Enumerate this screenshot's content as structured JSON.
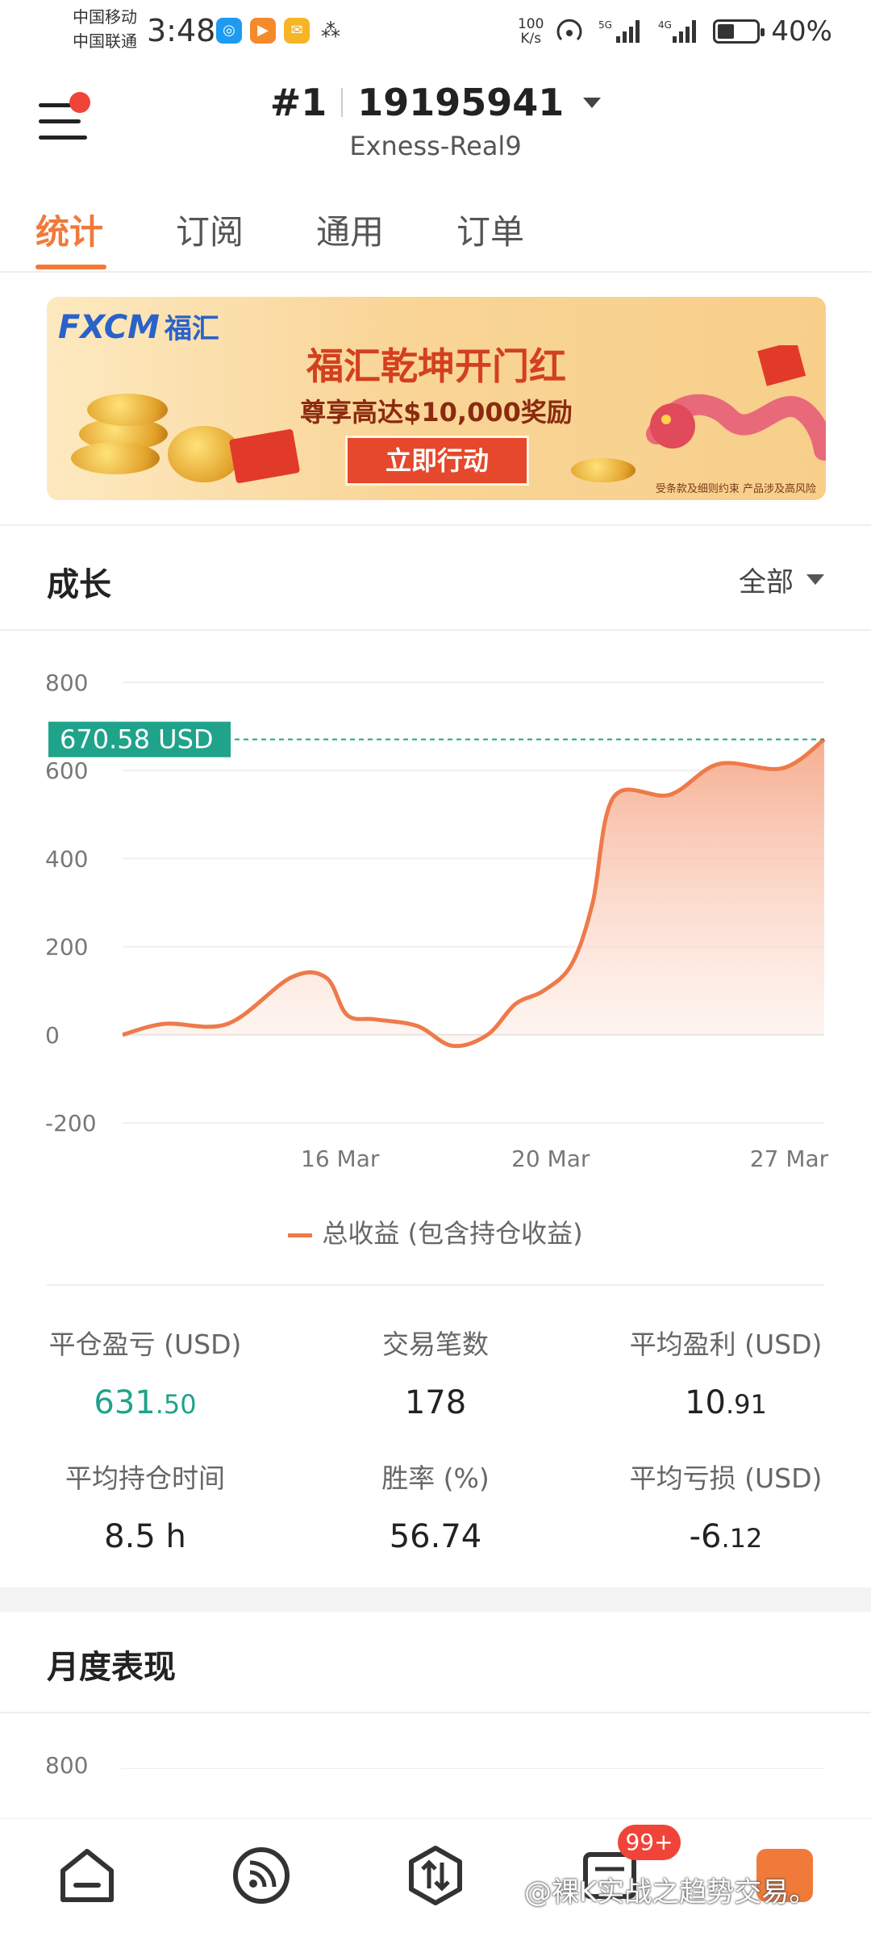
{
  "status_bar": {
    "carrier1": "中国移动",
    "carrier2": "中国联通",
    "time": "3:48",
    "net_speed_value": "100",
    "net_speed_unit": "K/s",
    "battery": "40%"
  },
  "header": {
    "account_index": "#1",
    "account_number": "19195941",
    "server": "Exness-Real9"
  },
  "tabs": [
    "统计",
    "订阅",
    "通用",
    "订单"
  ],
  "banner": {
    "brand": "FXCM",
    "brand_cn": "福汇",
    "title": "福汇乾坤开门红",
    "subtitle": "尊享高达$10,000奖励",
    "cta": "立即行动",
    "footnote": "受条款及细则约束  产品涉及高风险"
  },
  "growth": {
    "title": "成长",
    "range": "全部",
    "current_label": "670.58 USD",
    "legend": "总收益 (包含持仓收益)"
  },
  "chart_data": {
    "type": "area",
    "ylim": [
      -200,
      800
    ],
    "y_ticks": [
      800,
      600,
      400,
      200,
      0,
      -200
    ],
    "x_ticks": [
      "16 Mar",
      "20 Mar",
      "27 Mar"
    ],
    "series": [
      {
        "name": "总收益 (包含持仓收益)",
        "color": "#ee7a4a",
        "x": [
          0,
          0.06,
          0.15,
          0.24,
          0.29,
          0.32,
          0.36,
          0.42,
          0.47,
          0.52,
          0.56,
          0.6,
          0.64,
          0.67,
          0.7,
          0.78,
          0.85,
          0.94,
          1.0
        ],
        "values": [
          0,
          25,
          25,
          130,
          130,
          45,
          35,
          20,
          -25,
          0,
          70,
          100,
          160,
          300,
          540,
          545,
          615,
          605,
          670.58
        ]
      }
    ],
    "reference_line": 670.58
  },
  "stats": [
    {
      "label": "平仓盈亏 (USD)",
      "int": "631",
      "dec": ".50",
      "green": true
    },
    {
      "label": "交易笔数",
      "int": "178",
      "dec": "",
      "green": false
    },
    {
      "label": "平均盈利 (USD)",
      "int": "10",
      "dec": ".91",
      "green": false
    },
    {
      "label": "平均持仓时间",
      "int": "8.5 h",
      "dec": "",
      "green": false
    },
    {
      "label": "胜率 (%)",
      "int": "56.74",
      "dec": "",
      "green": false
    },
    {
      "label": "平均亏损 (USD)",
      "int": "-6",
      "dec": ".12",
      "green": false
    }
  ],
  "monthly": {
    "title": "月度表现",
    "first_tick": "800"
  },
  "bottom_nav": {
    "badge": "99+",
    "watermark": "@裸K实战之趋势交易。"
  },
  "colors": {
    "accent": "#f07a3a",
    "green": "#1fa38a",
    "line": "#ee7a4a",
    "badge": "#f04438"
  }
}
